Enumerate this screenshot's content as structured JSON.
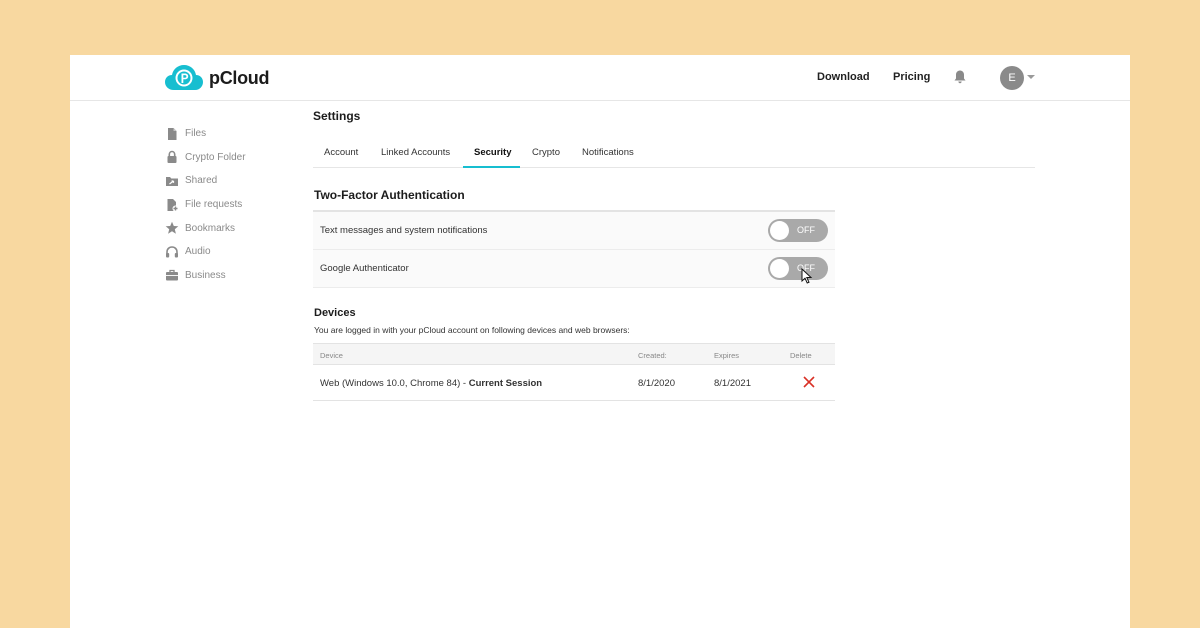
{
  "brand": {
    "name": "pCloud",
    "logo_color": "#17bed0"
  },
  "header": {
    "download_label": "Download",
    "pricing_label": "Pricing",
    "avatar_initial": "E"
  },
  "sidebar": {
    "items": [
      {
        "label": "Files",
        "icon": "file-icon"
      },
      {
        "label": "Crypto Folder",
        "icon": "lock-icon"
      },
      {
        "label": "Shared",
        "icon": "shared-folder-icon"
      },
      {
        "label": "File requests",
        "icon": "file-request-icon"
      },
      {
        "label": "Bookmarks",
        "icon": "star-icon"
      },
      {
        "label": "Audio",
        "icon": "headphones-icon"
      },
      {
        "label": "Business",
        "icon": "briefcase-icon"
      }
    ]
  },
  "settings": {
    "title": "Settings",
    "tabs": [
      "Account",
      "Linked Accounts",
      "Security",
      "Crypto",
      "Notifications"
    ],
    "active_tab": "Security",
    "accent_color": "#17bed0"
  },
  "two_factor": {
    "title": "Two-Factor Authentication",
    "rows": [
      {
        "label": "Text messages and system notifications",
        "state": "OFF"
      },
      {
        "label": "Google Authenticator",
        "state": "OFF"
      }
    ]
  },
  "devices": {
    "title": "Devices",
    "description": "You are logged in with your pCloud account on following devices and web browsers:",
    "columns": {
      "device": "Device",
      "created": "Created:",
      "expires": "Expires",
      "delete": "Delete"
    },
    "rows": [
      {
        "device": "Web (Windows 10.0, Chrome 84) - ",
        "session": "Current Session",
        "created": "8/1/2020",
        "expires": "8/1/2021"
      }
    ],
    "delete_color": "#d93025"
  }
}
